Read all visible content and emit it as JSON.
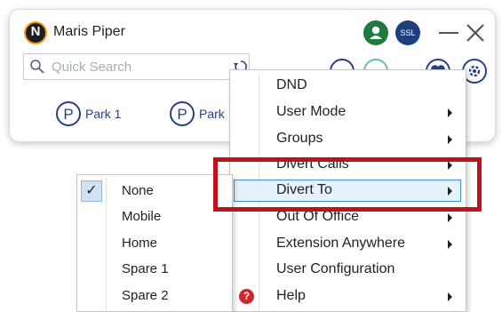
{
  "app": {
    "logo_letter": "N",
    "title": "Maris Piper",
    "ssl_label": "SSL"
  },
  "search": {
    "placeholder": "Quick Search"
  },
  "park": [
    {
      "icon_letter": "P",
      "label": "Park 1"
    },
    {
      "icon_letter": "P",
      "label": "Park"
    }
  ],
  "menu": {
    "items": [
      {
        "label": "DND",
        "submenu": false
      },
      {
        "label": "User Mode",
        "submenu": true
      },
      {
        "label": "Groups",
        "submenu": true
      },
      {
        "label": "Divert Calls",
        "submenu": true
      },
      {
        "label": "Divert To",
        "submenu": true,
        "highlighted": true
      },
      {
        "label": "Out Of Office",
        "submenu": true
      },
      {
        "label": "Extension Anywhere",
        "submenu": true
      },
      {
        "label": "User Configuration",
        "submenu": false
      },
      {
        "label": "Help",
        "submenu": true,
        "icon": "help-icon"
      }
    ],
    "help_icon_glyph": "?"
  },
  "divert_to_submenu": {
    "items": [
      {
        "label": "None",
        "checked": true
      },
      {
        "label": "Mobile",
        "checked": false
      },
      {
        "label": "Home",
        "checked": false
      },
      {
        "label": "Spare 1",
        "checked": false
      },
      {
        "label": "Spare 2",
        "checked": false
      }
    ],
    "check_glyph": "✓"
  },
  "colors": {
    "brand_blue": "#26418a",
    "user_green": "#1f7a3e",
    "ssl_blue": "#1d3f7c",
    "highlight_border": "#3d93d9",
    "callout_red": "#c1121b"
  }
}
